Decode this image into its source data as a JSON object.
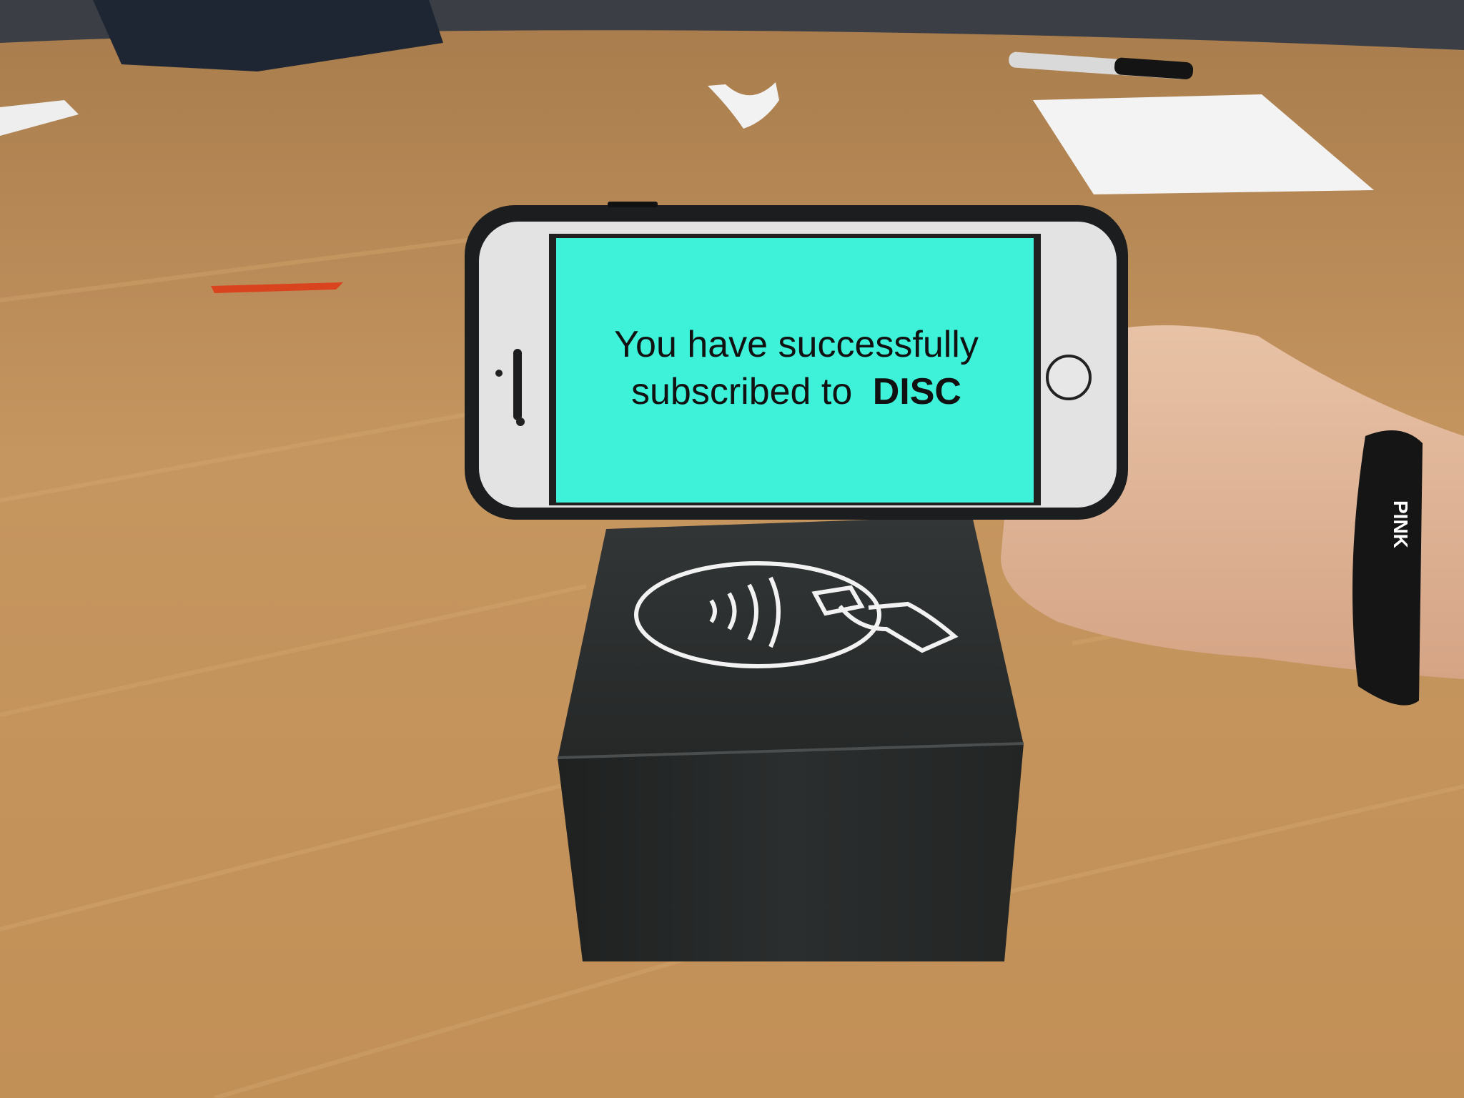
{
  "phone_screen": {
    "line1": "You have successfully",
    "line2_prefix": "subscribed to",
    "line2_brand": "DISC",
    "background_color": "#3ef2d9"
  },
  "scene": {
    "table_color": "#c2925b",
    "box_color": "#2a2d2d",
    "nfc_symbol": "contactless-payment-icon",
    "wristband_text": "PINK"
  }
}
